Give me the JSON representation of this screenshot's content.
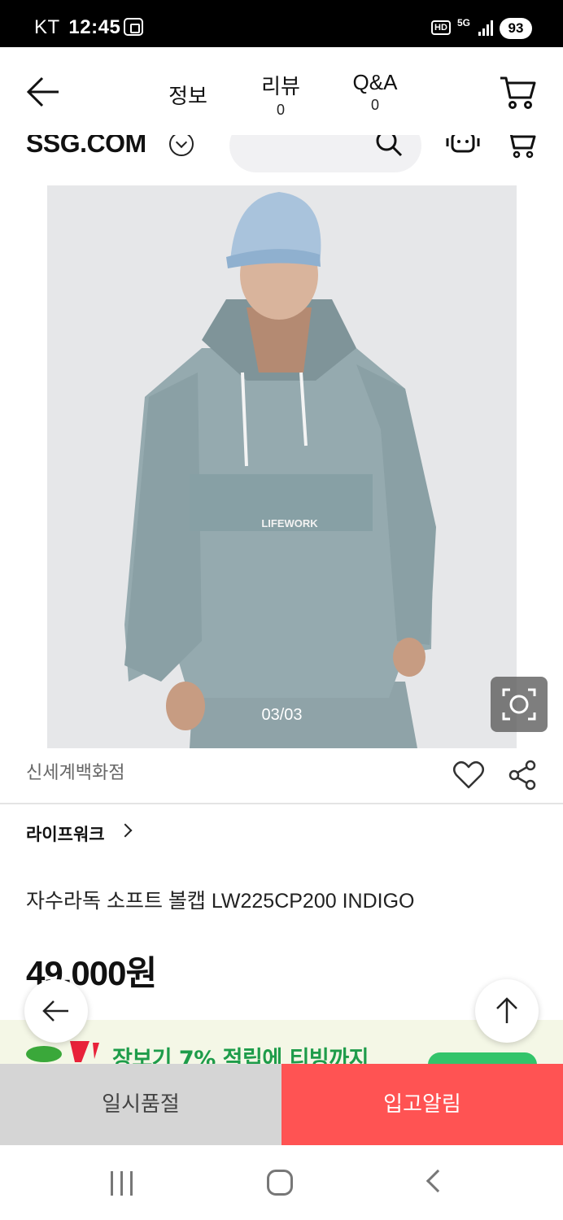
{
  "status_bar": {
    "carrier": "KT",
    "time": "12:45",
    "hd": "HD",
    "network": "5G",
    "battery": "93"
  },
  "top_bar": {
    "tabs": [
      {
        "label": "정보",
        "count": ""
      },
      {
        "label": "리뷰",
        "count": "0"
      },
      {
        "label": "Q&A",
        "count": "0"
      }
    ]
  },
  "ssg_header": {
    "logo": "SSG.COM"
  },
  "product": {
    "image_counter": "03/03",
    "image_alt_text": "LIFEWORK",
    "store": "신세계백화점",
    "brand": "라이프워크",
    "name": "자수라독 소프트 볼캡 LW225CP200 INDIGO",
    "price": "49,000원"
  },
  "promo": {
    "text": "장보기 7% 적립에 티빙까지"
  },
  "actions": {
    "soldout": "일시품절",
    "restock": "입고알림"
  },
  "colors": {
    "restock_button": "#ff5353",
    "soldout_button": "#d5d5d5",
    "promo_text": "#1e9c4a",
    "promo_bg": "#f4f7e6"
  },
  "icons": [
    "back-arrow-icon",
    "cart-icon",
    "chevron-down-icon",
    "search-icon",
    "chatbot-icon",
    "lens-icon",
    "heart-icon",
    "share-icon",
    "arrow-up-icon"
  ]
}
